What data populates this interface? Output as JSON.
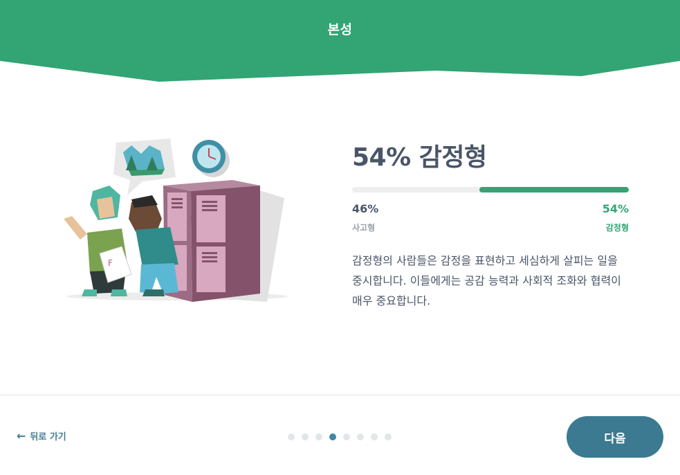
{
  "header": {
    "title": "본성",
    "color": "#33a474"
  },
  "result": {
    "title": "54% 감정형",
    "fill_fraction": 0.54,
    "left_percent": "46%",
    "left_label": "사고형",
    "right_percent": "54%",
    "right_label": "감정형",
    "description": "감정형의 사람들은 감정을 표현하고 세심하게 살피는 일을 중시합니다. 이들에게는 공감 능력과 사회적 조화와 협력이 매우 중요합니다."
  },
  "footer": {
    "back_label": "뒤로 가기",
    "next_label": "다음",
    "steps_total": 8,
    "current_step": 4
  },
  "colors": {
    "accent_green": "#33a474",
    "text_dark": "#4a5568",
    "button_teal": "#3b7a91"
  }
}
